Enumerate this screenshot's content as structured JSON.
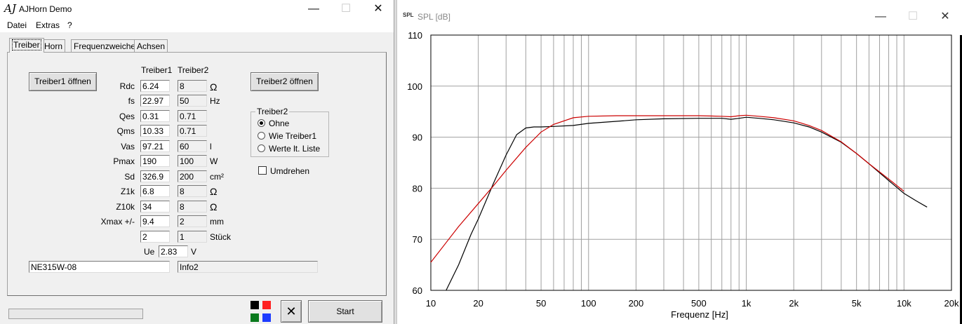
{
  "window1": {
    "icon": "AJ",
    "title": "AJHorn Demo",
    "controls": {
      "minimize": "—",
      "maximize": "☐",
      "close": "✕"
    },
    "menu": [
      "Datei",
      "Extras",
      "?"
    ],
    "tabs": [
      {
        "label": "Treiber",
        "active": true
      },
      {
        "label": "Horn",
        "active": false
      },
      {
        "label": "Frequenzweiche",
        "active": false
      },
      {
        "label": "Achsen",
        "active": false
      }
    ],
    "open_driver1": "Treiber1 öffnen",
    "open_driver2": "Treiber2 öffnen",
    "col1_header": "Treiber1",
    "col2_header": "Treiber2",
    "params": [
      {
        "name": "Rdc",
        "t1": "6.24",
        "t2": "8",
        "unit": "Ω"
      },
      {
        "name": "fs",
        "t1": "22.97",
        "t2": "50",
        "unit": "Hz"
      },
      {
        "name": "Qes",
        "t1": "0.31",
        "t2": "0.71",
        "unit": ""
      },
      {
        "name": "Qms",
        "t1": "10.33",
        "t2": "0.71",
        "unit": ""
      },
      {
        "name": "Vas",
        "t1": "97.21",
        "t2": "60",
        "unit": "l"
      },
      {
        "name": "Pmax",
        "t1": "190",
        "t2": "100",
        "unit": "W"
      },
      {
        "name": "Sd",
        "t1": "326.9",
        "t2": "200",
        "unit": "cm²"
      },
      {
        "name": "Z1k",
        "t1": "6.8",
        "t2": "8",
        "unit": "Ω"
      },
      {
        "name": "Z10k",
        "t1": "34",
        "t2": "8",
        "unit": "Ω"
      },
      {
        "name": "Xmax +/-",
        "t1": "9.4",
        "t2": "2",
        "unit": "mm"
      },
      {
        "name": "",
        "t1": "2",
        "t2": "1",
        "unit": "Stück"
      }
    ],
    "ue": {
      "label": "Ue",
      "value": "2.83",
      "unit": "V"
    },
    "name1": "NE315W-08",
    "name2": "Info2",
    "group": {
      "title": "Treiber2",
      "options": [
        {
          "label": "Ohne",
          "selected": true
        },
        {
          "label": "Wie Treiber1",
          "selected": false
        },
        {
          "label": "Werte lt. Liste",
          "selected": false
        }
      ]
    },
    "invert": {
      "label": "Umdrehen",
      "checked": false
    },
    "swatches": [
      "#000000",
      "#ff2020",
      "#0a7a1e",
      "#1e3cff"
    ],
    "clear_symbol": "✕",
    "start": "Start"
  },
  "window2": {
    "icon": "SPL",
    "title": "SPL [dB]",
    "controls": {
      "minimize": "—",
      "maximize": "☐",
      "close": "✕"
    }
  },
  "chart_data": {
    "type": "line",
    "xscale": "log",
    "xlim": [
      10,
      20000
    ],
    "ylim": [
      60,
      110
    ],
    "xlabel": "Frequenz [Hz]",
    "ylabel": "",
    "grid": true,
    "x_tick_values": [
      10,
      20,
      50,
      100,
      200,
      500,
      1000,
      2000,
      5000,
      10000,
      20000
    ],
    "x_tick_labels": [
      "10",
      "20",
      "50",
      "100",
      "200",
      "500",
      "1k",
      "2k",
      "5k",
      "10k",
      "20k"
    ],
    "y_tick_values": [
      60,
      70,
      80,
      90,
      100,
      110
    ],
    "series": [
      {
        "color": "#000000",
        "x": [
          12.5,
          15,
          18,
          20,
          25,
          30,
          35,
          40,
          45,
          50,
          60,
          80,
          100,
          150,
          200,
          300,
          500,
          700,
          800,
          900,
          1000,
          1200,
          1500,
          2000,
          2500,
          3000,
          4000,
          5000,
          6000,
          8000,
          10000,
          12000,
          14000
        ],
        "y": [
          60,
          65,
          71,
          74,
          81,
          86.5,
          90.5,
          91.8,
          92,
          92,
          92.1,
          92.3,
          92.7,
          93.1,
          93.4,
          93.6,
          93.7,
          93.7,
          93.5,
          93.7,
          93.9,
          93.7,
          93.4,
          92.8,
          92,
          91,
          89,
          86.8,
          84.8,
          81.5,
          79,
          77.5,
          76.3
        ]
      },
      {
        "color": "#cc0000",
        "x": [
          10,
          15,
          20,
          25,
          30,
          40,
          50,
          60,
          80,
          100,
          150,
          200,
          300,
          500,
          700,
          800,
          900,
          1000,
          1200,
          1500,
          2000,
          2500,
          3000,
          4000,
          5000,
          6000,
          8000,
          10000
        ],
        "y": [
          65.5,
          72.5,
          77,
          80.5,
          83.5,
          88,
          91,
          92.5,
          93.8,
          94.1,
          94.2,
          94.2,
          94.2,
          94.2,
          94.1,
          94,
          94.2,
          94.3,
          94.1,
          93.8,
          93.2,
          92.3,
          91.3,
          89.1,
          86.8,
          84.8,
          81.8,
          79.4
        ]
      }
    ]
  }
}
